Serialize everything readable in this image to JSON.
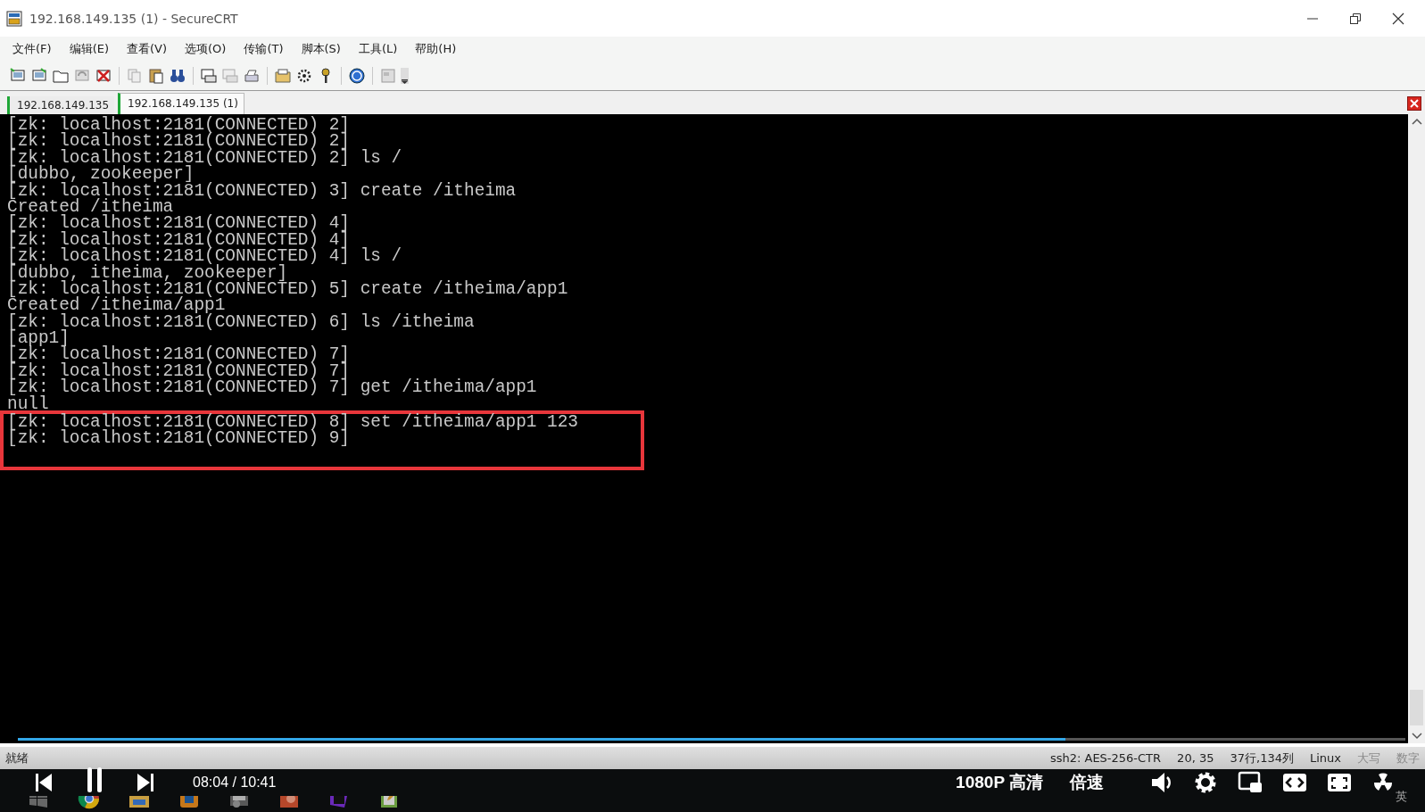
{
  "window": {
    "title": "192.168.149.135 (1) - SecureCRT"
  },
  "menu": [
    "文件(F)",
    "编辑(E)",
    "查看(V)",
    "选项(O)",
    "传输(T)",
    "脚本(S)",
    "工具(L)",
    "帮助(H)"
  ],
  "tabs": [
    {
      "label": "192.168.149.135",
      "selected": false
    },
    {
      "label": "192.168.149.135 (1)",
      "selected": true
    }
  ],
  "terminal": {
    "lines": [
      "[zk: localhost:2181(CONNECTED) 2]",
      "[zk: localhost:2181(CONNECTED) 2]",
      "[zk: localhost:2181(CONNECTED) 2] ls /",
      "[dubbo, zookeeper]",
      "[zk: localhost:2181(CONNECTED) 3] create /itheima",
      "Created /itheima",
      "[zk: localhost:2181(CONNECTED) 4]",
      "[zk: localhost:2181(CONNECTED) 4]",
      "[zk: localhost:2181(CONNECTED) 4] ls /",
      "[dubbo, itheima, zookeeper]",
      "[zk: localhost:2181(CONNECTED) 5] create /itheima/app1",
      "Created /itheima/app1",
      "[zk: localhost:2181(CONNECTED) 6] ls /itheima",
      "[app1]",
      "[zk: localhost:2181(CONNECTED) 7]",
      "[zk: localhost:2181(CONNECTED) 7]",
      "[zk: localhost:2181(CONNECTED) 7] get /itheima/app1",
      "null"
    ],
    "highlight_box": {
      "lines": [
        "[zk: localhost:2181(CONNECTED) 8] set /itheima/app1 123",
        "[zk: localhost:2181(CONNECTED) 9]"
      ]
    }
  },
  "video_progress": {
    "level": 0.755
  },
  "status_bar": {
    "message": "就绪",
    "items": [
      {
        "text": "ssh2: AES-256-CTR",
        "disabled": false
      },
      {
        "text": "20,  35",
        "disabled": false
      },
      {
        "text": "37行,134列",
        "disabled": false
      },
      {
        "text": "Linux",
        "disabled": false
      },
      {
        "text": "大写",
        "disabled": true
      },
      {
        "text": "数字",
        "disabled": true
      }
    ]
  },
  "player": {
    "time": "08:04 / 10:41",
    "quality": "1080P 高清",
    "speed": "倍速"
  },
  "taskbar": {
    "input_method": "英"
  }
}
